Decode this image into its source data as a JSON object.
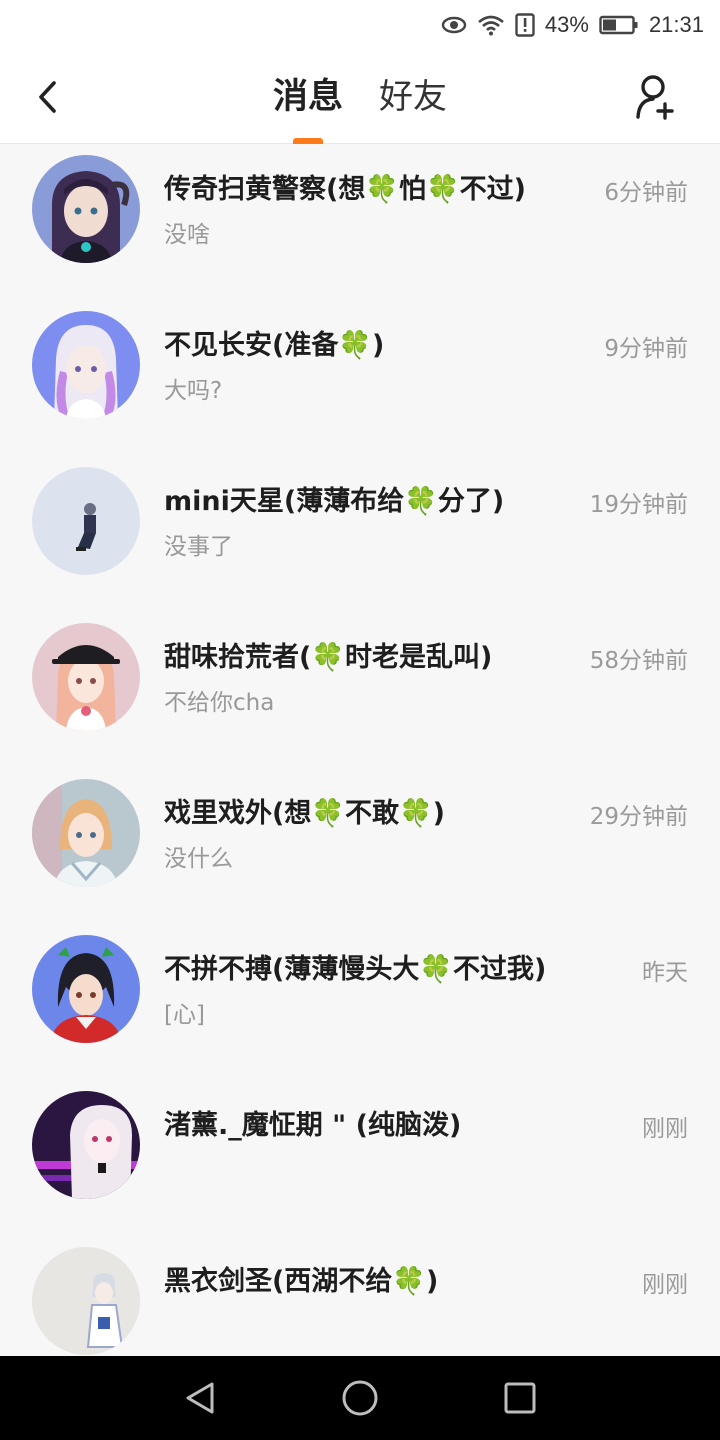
{
  "status_bar": {
    "battery_percent": "43%",
    "time": "21:31",
    "icons": [
      "eye-icon",
      "wifi-icon",
      "alert-icon",
      "battery-icon"
    ]
  },
  "header": {
    "back_icon": "back-arrow-icon",
    "tabs": [
      {
        "label": "消息",
        "active": true
      },
      {
        "label": "好友",
        "active": false
      }
    ],
    "add_friend_icon": "add-friend-icon",
    "accent_color": "#ff7a1a"
  },
  "conversations": [
    {
      "name": "传奇扫黄警察(想🍀怕🍀不过)",
      "preview": "没啥",
      "time": "6分钟前",
      "avatar_color": "#8a9cd8"
    },
    {
      "name": "不见长安(准备🍀)",
      "preview": "大吗?",
      "time": "9分钟前",
      "avatar_color": "#7d8df0"
    },
    {
      "name": "mini天星(薄薄布给🍀分了)",
      "preview": "没事了",
      "time": "19分钟前",
      "avatar_color": "#dde3ee"
    },
    {
      "name": "甜味拾荒者(🍀时老是乱叫)",
      "preview": "不给你cha",
      "time": "58分钟前",
      "avatar_color": "#e6c9cf"
    },
    {
      "name": "戏里戏外(想🍀不敢🍀)",
      "preview": "没什么",
      "time": "29分钟前",
      "avatar_color": "#b9c7cf"
    },
    {
      "name": "不拼不搏(薄薄慢头大🍀不过我)",
      "preview": "[心]",
      "time": "昨天",
      "avatar_color": "#6d86ea"
    },
    {
      "name": "渚薰._魔怔期 \" (纯脑泼)",
      "preview": "",
      "time": "刚刚",
      "avatar_color": "#2a1640"
    },
    {
      "name": "黑衣剑圣(西湖不给🍀)",
      "preview": "",
      "time": "刚刚",
      "avatar_color": "#e8e6e2"
    }
  ],
  "nav_bar": {
    "icons": [
      "back-triangle-icon",
      "home-circle-icon",
      "recents-square-icon"
    ]
  }
}
